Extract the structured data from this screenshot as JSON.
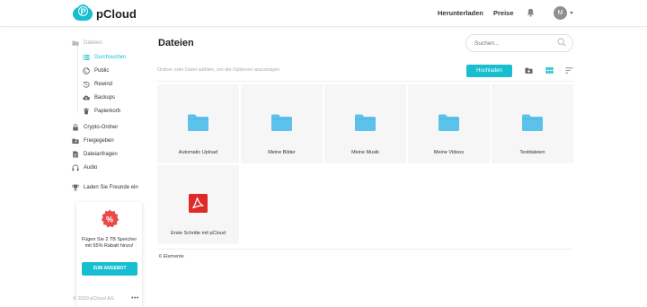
{
  "header": {
    "brand": "pCloud",
    "nav": [
      "Herunterladen",
      "Preise"
    ],
    "avatar_initial": "M",
    "icons": [
      "bell-icon",
      "chevron-down-icon"
    ]
  },
  "sidebar": {
    "items": [
      {
        "label": "Dateien",
        "icon": "folder-icon",
        "state": "muted"
      },
      {
        "label": "Durchsuchen",
        "icon": "list-icon",
        "state": "active"
      },
      {
        "label": "Public",
        "icon": "globe-icon",
        "state": "normal"
      },
      {
        "label": "Rewind",
        "icon": "history-icon",
        "state": "normal"
      },
      {
        "label": "Backups",
        "icon": "cloud-upload-icon",
        "state": "normal"
      },
      {
        "label": "Papierkorb",
        "icon": "trash-icon",
        "state": "normal"
      },
      {
        "label": "Crypto-Ordner",
        "icon": "lock-icon",
        "state": "normal"
      },
      {
        "label": "Freigegeben",
        "icon": "shared-folder-icon",
        "state": "normal"
      },
      {
        "label": "Dateianfragen",
        "icon": "file-request-icon",
        "state": "normal"
      },
      {
        "label": "Audio",
        "icon": "headphones-icon",
        "state": "normal"
      },
      {
        "label": "Laden Sie Freunde ein",
        "icon": "trophy-icon",
        "state": "normal"
      }
    ],
    "promo": {
      "badge": "%",
      "text": "Fügen Sie 2 TB Speicher mit 65% Rabatt hinzu!",
      "button": "ZUM ANGEBOT"
    },
    "footer": {
      "copyright": "© 2020 pCloud AG",
      "more": "•••"
    }
  },
  "main": {
    "title": "Dateien",
    "search_placeholder": "Suchen...",
    "hint": "Ordner oder Datei wählen, um die Optionen anzuzeigen",
    "upload_label": "Hochladen",
    "files": [
      {
        "name": "Automatic Upload",
        "type": "folder"
      },
      {
        "name": "Meine Bilder",
        "type": "folder"
      },
      {
        "name": "Meine Musik",
        "type": "folder"
      },
      {
        "name": "Meine Videos",
        "type": "folder"
      },
      {
        "name": "Testdateien",
        "type": "folder"
      },
      {
        "name": "Erste Schritte mit pCloud",
        "type": "pdf"
      }
    ],
    "count": "6 Elemente"
  },
  "colors": {
    "accent": "#17bed0",
    "folder": "#5cc2ec",
    "pdf": "#e02a2a",
    "promo_badge": "#e84a4a"
  }
}
